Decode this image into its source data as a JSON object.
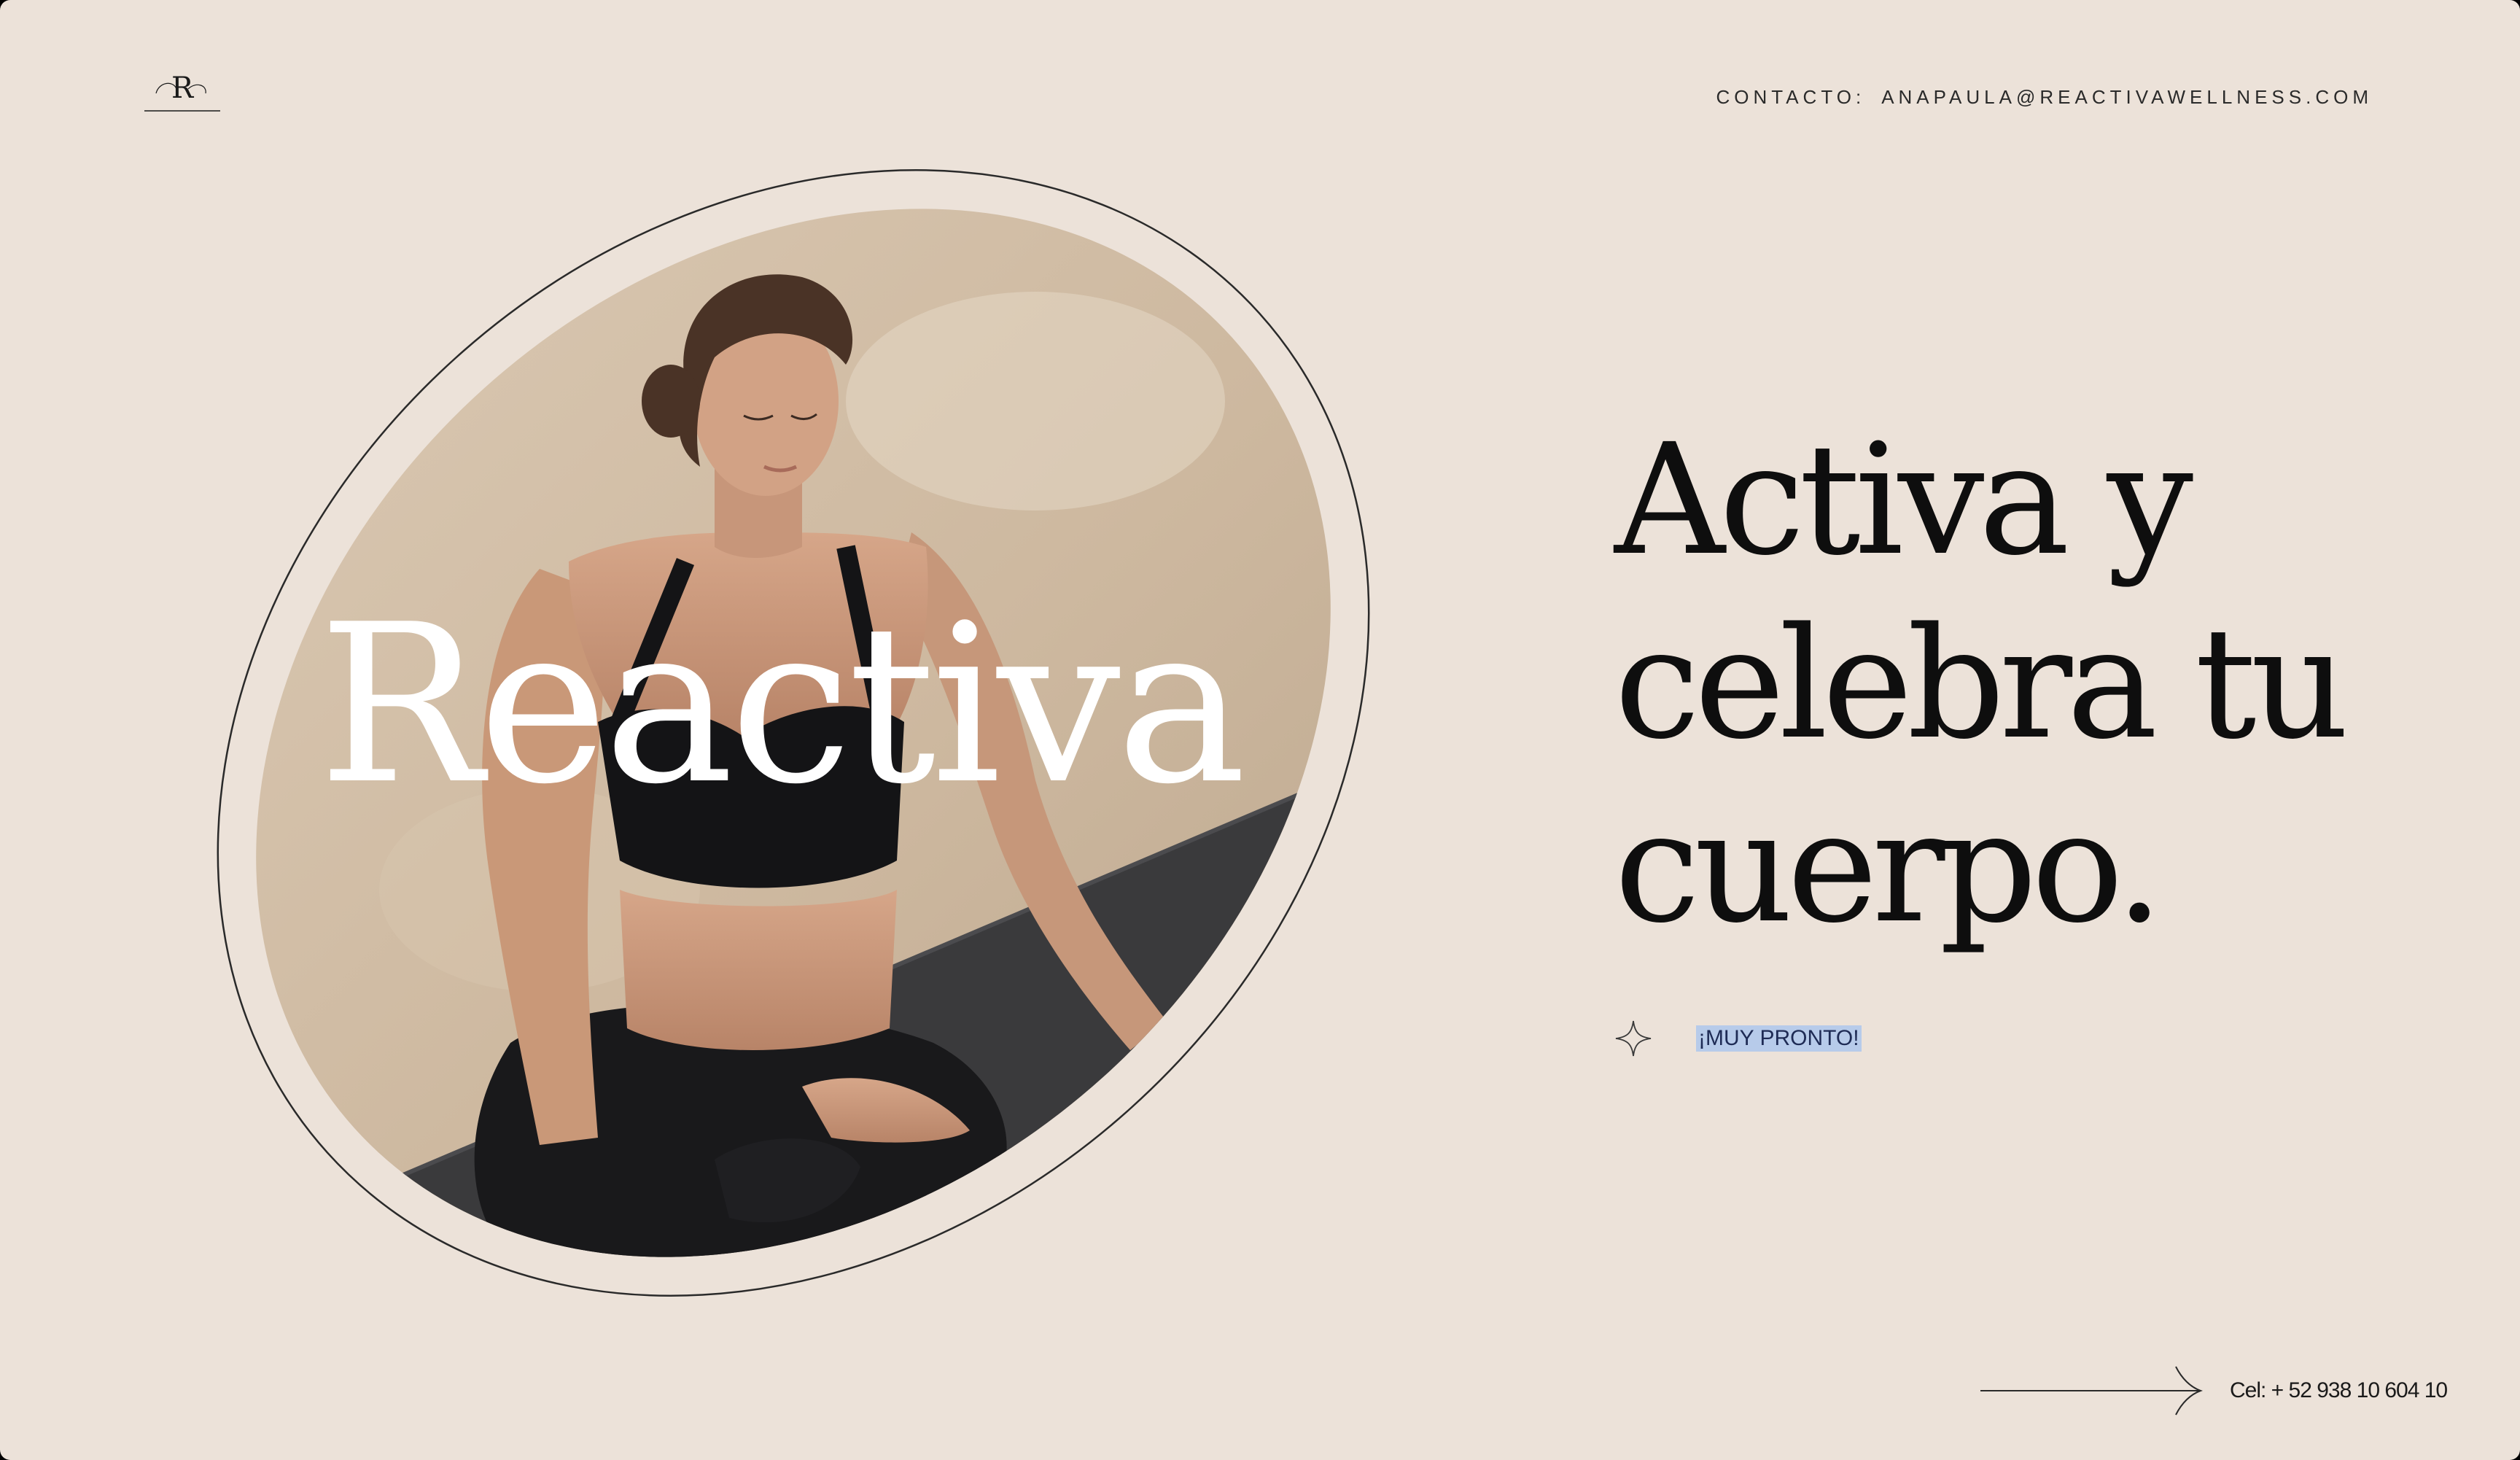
{
  "header": {
    "logo_letter": "R",
    "contact_label": "CONTACTO:",
    "contact_email": "ANAPAULA@REACTIVAWELLNESS.COM"
  },
  "hero": {
    "brand_wordmark": "Reactiva",
    "image_alt": "woman-meditating-photo",
    "headline_lines": [
      "Activa y",
      "celebra tu",
      "cuerpo."
    ]
  },
  "announcement": {
    "icon": "sparkle-icon",
    "label": "¡MUY PRONTO!"
  },
  "footer": {
    "icon": "arrow-right-icon",
    "phone": "Cel: + 52 938 10 604 10"
  },
  "colors": {
    "background": "#ece2d9",
    "text": "#141414",
    "highlight": "#b7cbea"
  }
}
